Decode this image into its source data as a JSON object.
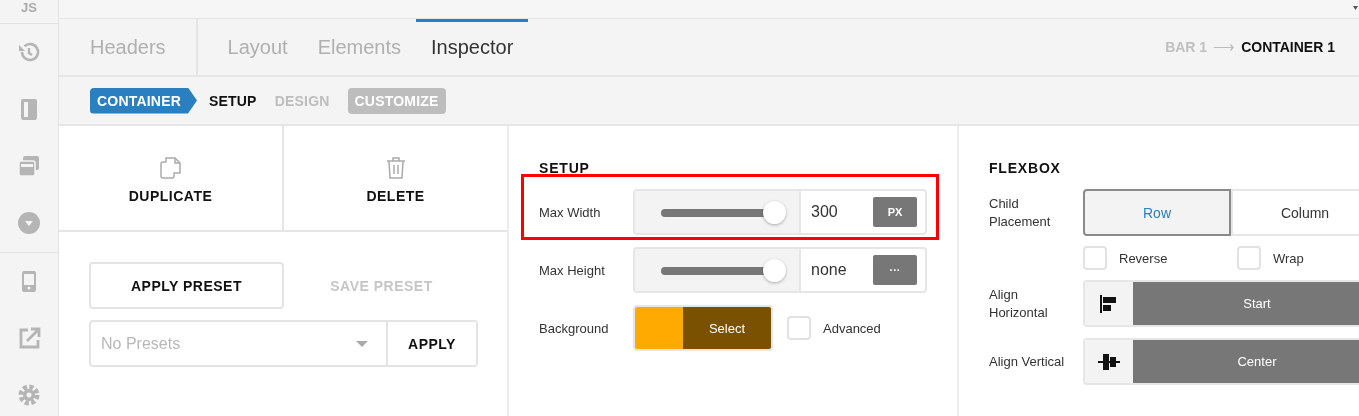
{
  "sidebar": {
    "label": "JS"
  },
  "tabs": [
    {
      "label": "Headers",
      "selected": false
    },
    {
      "label": "Layout",
      "selected": false
    },
    {
      "label": "Elements",
      "selected": false
    },
    {
      "label": "Inspector",
      "selected": true
    }
  ],
  "breadcrumb": {
    "items": [
      {
        "label": "BAR 1",
        "current": false
      },
      {
        "label": "CONTAINER 1",
        "current": true
      }
    ],
    "separator": "⟶"
  },
  "subnav": [
    {
      "label": "CONTAINER",
      "kind": "badge"
    },
    {
      "label": "SETUP",
      "kind": "step",
      "selected": true
    },
    {
      "label": "DESIGN",
      "kind": "step",
      "selected": false
    },
    {
      "label": "CUSTOMIZE",
      "kind": "pill"
    }
  ],
  "actions": [
    {
      "label": "DUPLICATE",
      "kind": "duplicate"
    },
    {
      "label": "DELETE",
      "kind": "delete"
    }
  ],
  "presets": {
    "apply_preset": {
      "label": "APPLY PRESET",
      "disabled": false
    },
    "save_preset": {
      "label": "SAVE PRESET",
      "disabled": true
    },
    "select": {
      "placeholder": "No Presets"
    },
    "apply": "APPLY"
  },
  "setup": {
    "title": "SETUP",
    "rows": [
      {
        "kind": "slider",
        "label": "Max Width",
        "level": 1.0,
        "value": "300",
        "unit": "PX",
        "highlighted": true
      },
      {
        "kind": "slider",
        "label": "Max Height",
        "level": 1.0,
        "value": "none",
        "unit": "···",
        "highlighted": false
      },
      {
        "kind": "color",
        "label": "Background",
        "color": "#ffaa00",
        "button": "Select",
        "checkbox": {
          "label": "Advanced",
          "checked": false
        }
      }
    ]
  },
  "flexbox": {
    "title": "FLEXBOX",
    "placement": {
      "label": "Child Placement",
      "options": [
        {
          "label": "Row",
          "selected": true
        },
        {
          "label": "Column",
          "selected": false
        }
      ]
    },
    "checkboxes": [
      {
        "label": "Reverse",
        "checked": false
      },
      {
        "label": "Wrap",
        "checked": false
      }
    ],
    "aligns": [
      {
        "label": "Align Horizontal",
        "kind": "start",
        "value": "Start"
      },
      {
        "label": "Align Vertical",
        "kind": "center",
        "value": "Center"
      }
    ]
  }
}
